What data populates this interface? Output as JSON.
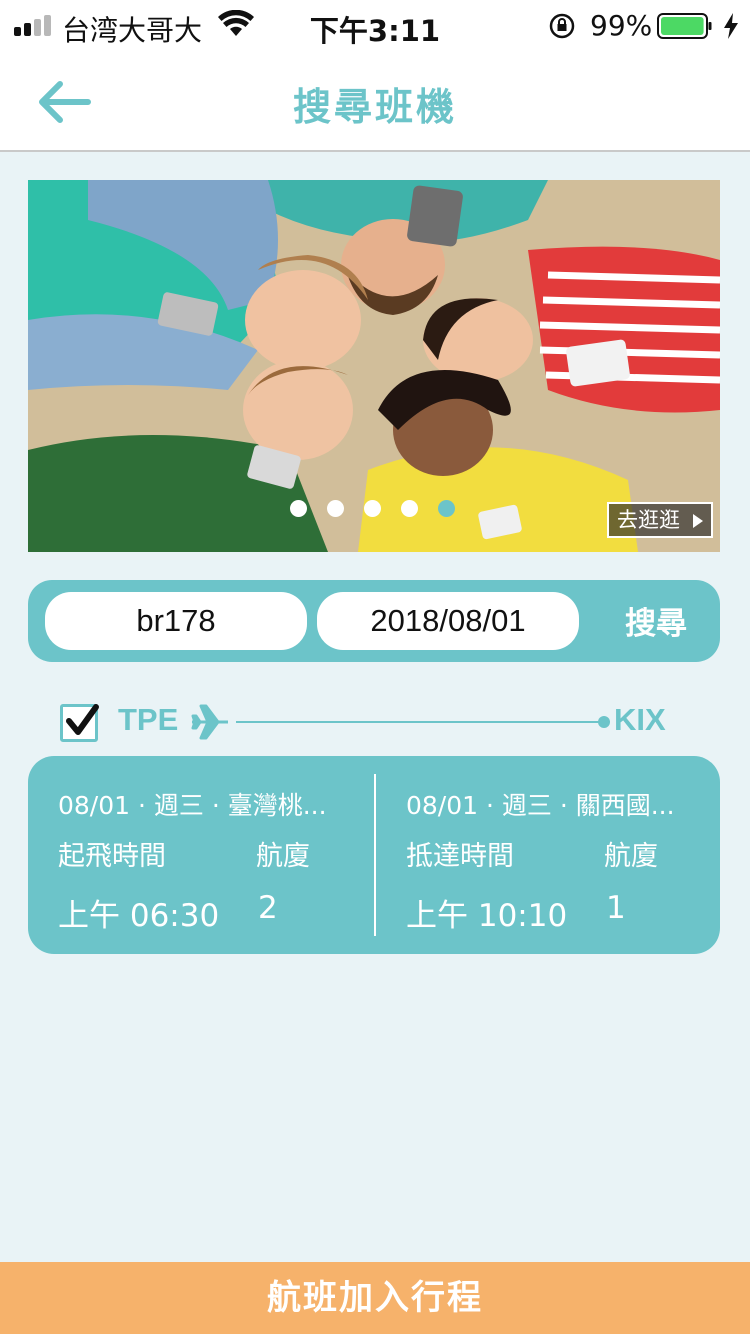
{
  "status_bar": {
    "carrier": "台湾大哥大",
    "time": "下午3:11",
    "battery_percent": "99%",
    "battery_level": 0.99,
    "icons": [
      "signal-icon",
      "wifi-icon",
      "orientation-lock-icon",
      "battery-icon",
      "charging-icon"
    ]
  },
  "nav": {
    "title": "搜尋班機",
    "back_icon": "arrow-left-icon"
  },
  "banner": {
    "explore_label": "去逛逛",
    "slide_count": 5,
    "active_slide": 5
  },
  "search": {
    "flight_number": "br178",
    "date": "2018/08/01",
    "search_label": "搜尋"
  },
  "route": {
    "checked": true,
    "origin": "TPE",
    "destination": "KIX"
  },
  "flight": {
    "depart": {
      "date_line": "08/01 · 週三 · 臺灣桃...",
      "time_label": "起飛時間",
      "terminal_label": "航廈",
      "time": "上午 06:30",
      "terminal": "2"
    },
    "arrive": {
      "date_line": "08/01 · 週三 · 關西國...",
      "time_label": "抵達時間",
      "terminal_label": "航廈",
      "time": "上午 10:10",
      "terminal": "1"
    }
  },
  "footer": {
    "add_trip_label": "航班加入行程"
  },
  "colors": {
    "accent": "#6cc4c9",
    "background": "#e9f3f6",
    "footer_button": "#f6b26b"
  }
}
